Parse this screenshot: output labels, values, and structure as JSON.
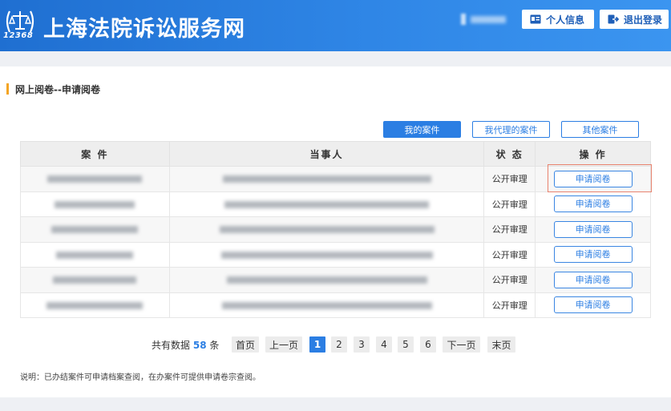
{
  "header": {
    "logo_number": "12368",
    "site_title": "上海法院诉讼服务网",
    "profile_label": "个人信息",
    "logout_label": "退出登录",
    "bg_color": "#2a7fe0"
  },
  "section": {
    "title": "网上阅卷--申请阅卷"
  },
  "tabs": [
    {
      "label": "我的案件",
      "active": true
    },
    {
      "label": "我代理的案件",
      "active": false
    },
    {
      "label": "其他案件",
      "active": false
    }
  ],
  "table": {
    "columns": [
      "案 件",
      "当事人",
      "状 态",
      "操 作"
    ],
    "rows": [
      {
        "status": "公开审理",
        "action": "申请阅卷"
      },
      {
        "status": "公开审理",
        "action": "申请阅卷"
      },
      {
        "status": "公开审理",
        "action": "申请阅卷"
      },
      {
        "status": "公开审理",
        "action": "申请阅卷"
      },
      {
        "status": "公开审理",
        "action": "申请阅卷"
      },
      {
        "status": "公开审理",
        "action": "申请阅卷"
      }
    ]
  },
  "pagination": {
    "total_prefix": "共有数据",
    "total_count": "58",
    "total_suffix": "条",
    "first": "首页",
    "prev": "上一页",
    "pages": [
      "1",
      "2",
      "3",
      "4",
      "5",
      "6"
    ],
    "current_page": "1",
    "next": "下一页",
    "last": "末页"
  },
  "note": "说明：已办结案件可申请档案查阅，在办案件可提供申请卷宗查阅。"
}
